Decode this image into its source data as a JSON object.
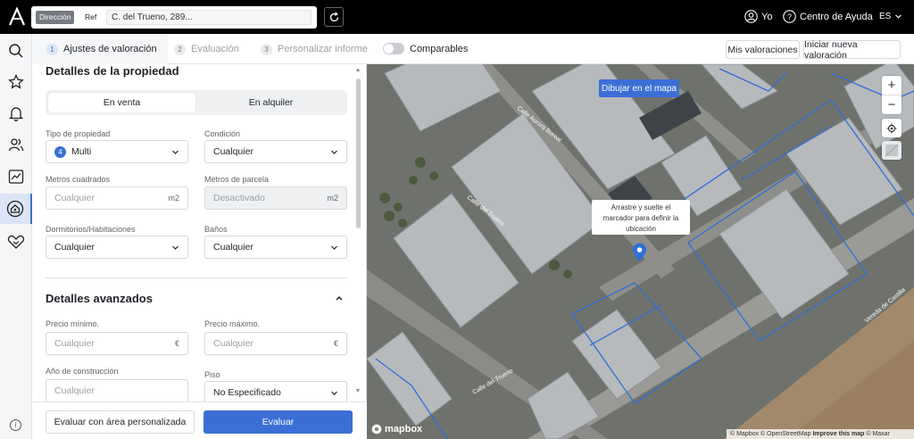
{
  "topbar": {
    "address_mode": "Dirección",
    "ref_mode": "Ref",
    "address_value": "C. del Trueno, 289...",
    "user_label": "Yo",
    "help_label": "Centro de Ayuda",
    "lang_label": "ES"
  },
  "steps": [
    {
      "num": "1",
      "label": "Ajustes de valoración"
    },
    {
      "num": "2",
      "label": "Evaluación"
    },
    {
      "num": "3",
      "label": "Personalizar informe"
    }
  ],
  "comparables_label": "Comparables",
  "comparables_on": false,
  "header_buttons": {
    "my_valuations": "Mis valoraciones",
    "new_valuation": "Iniciar nueva valoración"
  },
  "property": {
    "title": "Detalles de la propiedad",
    "sale_tab": "En venta",
    "rent_tab": "En alquiler",
    "type_label": "Tipo de propiedad",
    "type_badge": "4",
    "type_value": "Multi",
    "condition_label": "Condición",
    "condition_value": "Cualquier",
    "sqm_label": "Metros cuadrados",
    "sqm_placeholder": "Cualquier",
    "sqm_unit": "m2",
    "plot_label": "Metros de parcela",
    "plot_placeholder": "Desactivado",
    "plot_unit": "m2",
    "rooms_label": "Dormitorios/Habitaciones",
    "rooms_value": "Cualquier",
    "baths_label": "Baños",
    "baths_value": "Cualquier"
  },
  "advanced": {
    "title": "Detalles avanzados",
    "min_price_label": "Precio mínimo.",
    "min_price_placeholder": "Cualquier",
    "min_price_unit": "€",
    "max_price_label": "Precio máximo.",
    "max_price_placeholder": "Cualquier",
    "max_price_unit": "€",
    "year_label": "Año de construcción",
    "year_placeholder": "Cualquier",
    "floor_label": "Piso",
    "floor_value": "No Especificado"
  },
  "footer": {
    "custom_area": "Evaluar con área personalizada",
    "evaluate": "Evaluar"
  },
  "map": {
    "draw_button": "Dibujar en el mapa",
    "tooltip_lines": [
      "Arrastre y suelte el",
      "marcador para definir la",
      "ubicación"
    ],
    "street_labels": [
      "Calle Aurora Boreal",
      "Calle del Trueno",
      "Calle del Trueno",
      "Vereda de Castilla"
    ],
    "logo": "mapbox",
    "attribution_1": "© Mapbox © OpenStreetMap",
    "attribution_2": "Improve this map",
    "attribution_3": "© Maxar",
    "accent": "#3b6fd6",
    "outline_color": "#2f6fd6"
  }
}
